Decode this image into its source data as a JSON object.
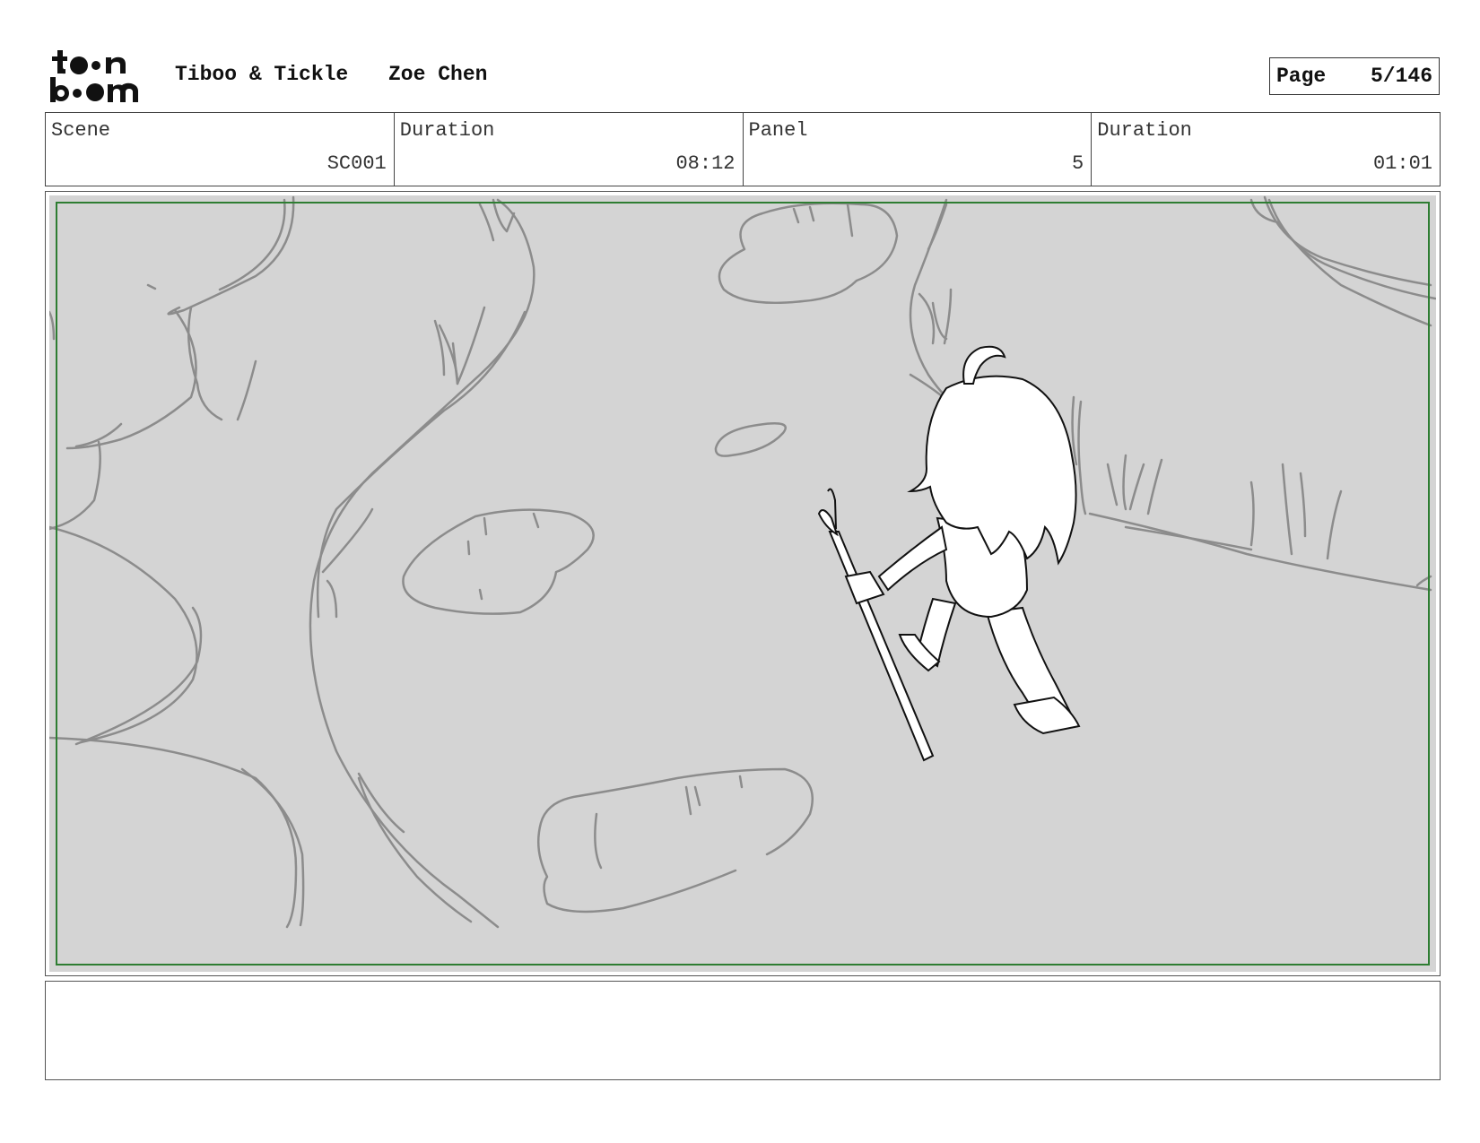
{
  "header": {
    "logo_text": "toon boom",
    "project": "Tiboo & Tickle",
    "author": "Zoe Chen",
    "page_label": "Page",
    "page_value": "5/146"
  },
  "info": {
    "scene_label": "Scene",
    "scene_value": "SC001",
    "scene_duration_label": "Duration",
    "scene_duration_value": "08:12",
    "panel_label": "Panel",
    "panel_value": "5",
    "panel_duration_label": "Duration",
    "panel_duration_value": "01:01"
  },
  "panel": {
    "image_alt": "Storyboard sketch: a child character with a walking stick walking across a grassy field with rocks and large shrubs",
    "safe_frame_color": "#2e7d32",
    "background_color": "#d4d4d4"
  },
  "notes": {
    "text": ""
  }
}
